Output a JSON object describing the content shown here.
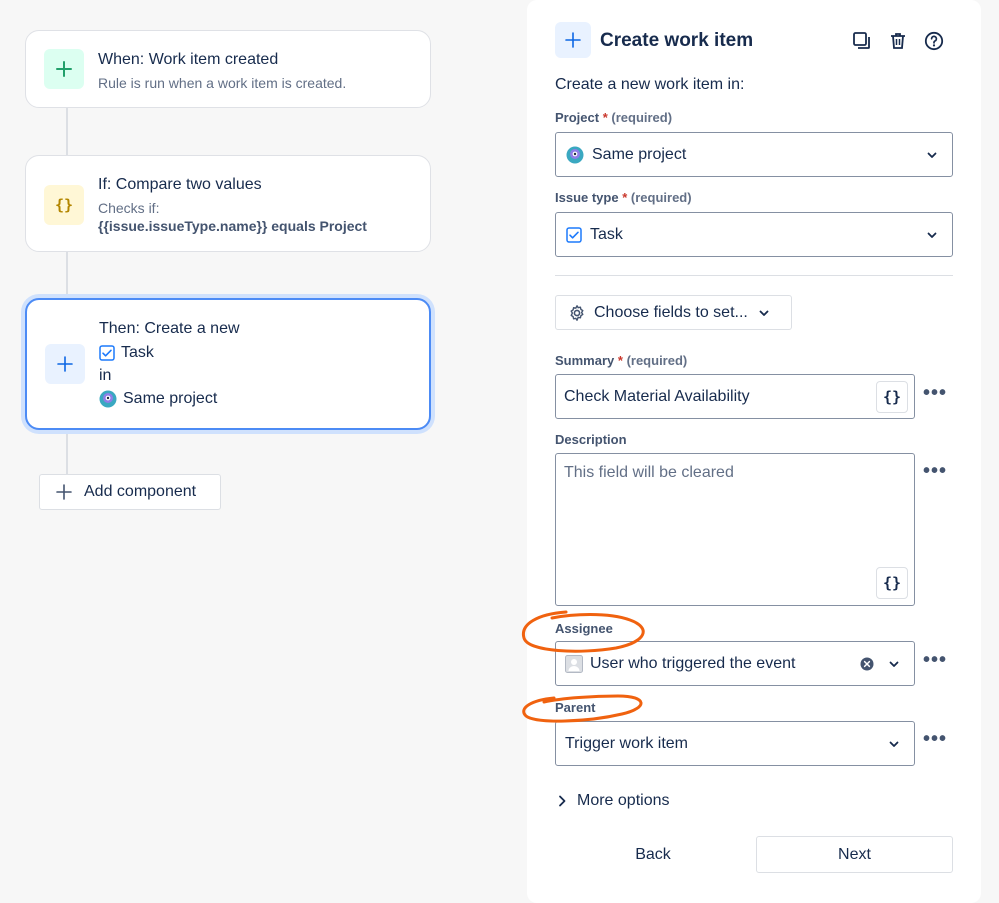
{
  "rule": {
    "trigger": {
      "title": "When: Work item created",
      "subtitle": "Rule is run when a work item is created."
    },
    "condition": {
      "title": "If: Compare two values",
      "subtitle_prefix": "Checks if:",
      "subtitle_expr": "{{issue.issueType.name}} equals Project"
    },
    "action": {
      "title": "Then: Create a new",
      "issue_type": "Task",
      "in_word": "in",
      "project": "Same project"
    },
    "add_component_label": "Add component"
  },
  "panel": {
    "title": "Create work item",
    "intro": "Create a new work item in:",
    "project": {
      "label": "Project",
      "required": "(required)",
      "value": "Same project"
    },
    "issue_type": {
      "label": "Issue type",
      "required": "(required)",
      "value": "Task"
    },
    "choose_fields_label": "Choose fields to set...",
    "summary": {
      "label": "Summary",
      "required": "(required)",
      "value": "Check Material Availability"
    },
    "description": {
      "label": "Description",
      "placeholder": "This field will be cleared"
    },
    "assignee": {
      "label": "Assignee",
      "value": "User who triggered the event"
    },
    "parent": {
      "label": "Parent",
      "value": "Trigger work item"
    },
    "more_options_label": "More options",
    "back_label": "Back",
    "next_label": "Next",
    "code_button_glyph": "{}",
    "more_glyph": "•••",
    "required_star": "*"
  },
  "colors": {
    "accent": "#0c66e4",
    "trigger_icon_bg": "#dcfff1",
    "trigger_icon": "#22a06b",
    "condition_icon_bg": "#fff7d6",
    "condition_icon": "#b38600",
    "annotation": "#f0620f"
  }
}
